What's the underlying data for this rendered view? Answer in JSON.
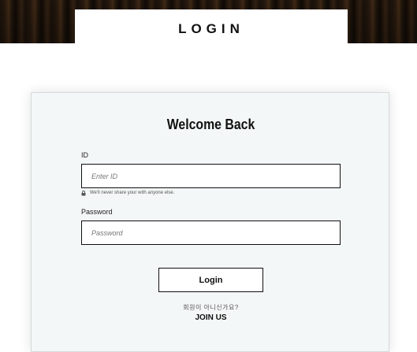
{
  "header": {
    "title": "LOGIN"
  },
  "card": {
    "heading": "Welcome Back",
    "id_field": {
      "label": "ID",
      "placeholder": "Enter ID",
      "value": "",
      "help_text": "We'll never share your with anyone else."
    },
    "password_field": {
      "label": "Password",
      "placeholder": "Password",
      "value": ""
    },
    "login_button": "Login",
    "not_member_text": "회원이 아니신가요?",
    "join_link": "JOIN US"
  },
  "icons": {
    "help": "lock-icon"
  },
  "colors": {
    "card_background": "#f4f7f7",
    "text": "#111111",
    "border": "#111111"
  }
}
